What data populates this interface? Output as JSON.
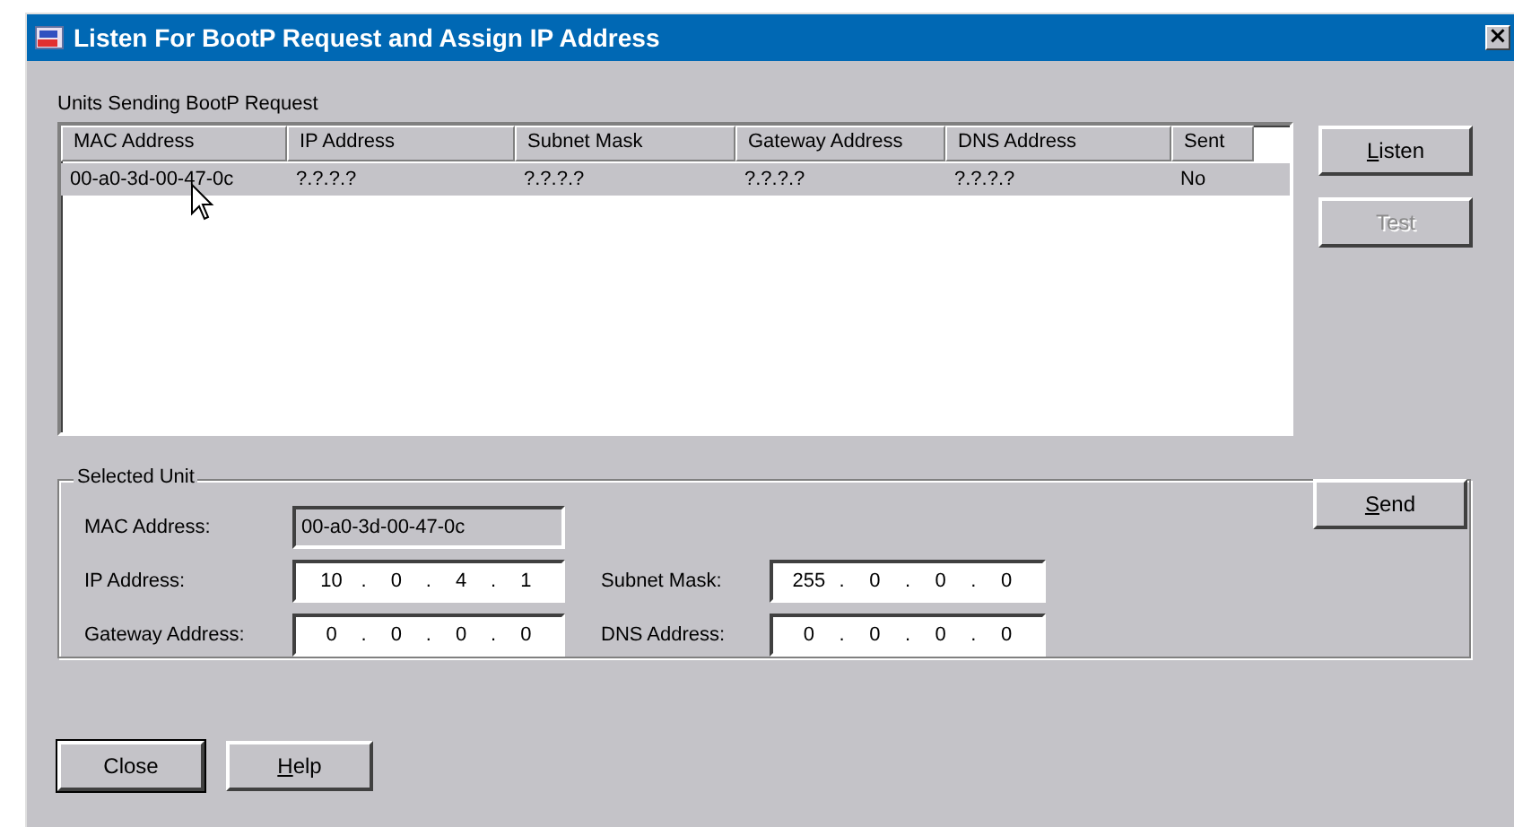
{
  "window": {
    "title": "Listen For BootP Request and Assign IP Address",
    "close_glyph": "×"
  },
  "units": {
    "label": "Units Sending BootP Request",
    "columns": [
      "MAC Address",
      "IP Address",
      "Subnet Mask",
      "Gateway Address",
      "DNS Address",
      "Sent"
    ],
    "rows": [
      {
        "selected": true,
        "cells": [
          "00-a0-3d-00-47-0c",
          "?.?.?.?",
          "?.?.?.?",
          "?.?.?.?",
          "?.?.?.?",
          "No"
        ]
      }
    ]
  },
  "side_buttons": [
    {
      "label": "Listen",
      "disabled": false,
      "underline_first": true
    },
    {
      "label": "Test",
      "disabled": true,
      "underline_first": false
    }
  ],
  "selected_unit": {
    "label": "Selected Unit",
    "separator": ".",
    "mac": {
      "label": "MAC Address:",
      "value": "00-a0-3d-00-47-0c"
    },
    "fields": [
      {
        "label": "IP Address:",
        "octets": [
          "10",
          "0",
          "4",
          "1"
        ]
      },
      {
        "label": "Subnet Mask:",
        "octets": [
          "255",
          "0",
          "0",
          "0"
        ]
      },
      {
        "label": "Gateway Address:",
        "octets": [
          "0",
          "0",
          "0",
          "0"
        ]
      },
      {
        "label": "DNS Address:",
        "octets": [
          "0",
          "0",
          "0",
          "0"
        ]
      }
    ],
    "send": {
      "label": "Send",
      "disabled": false,
      "underline_first": true
    }
  },
  "bottom_buttons": [
    {
      "label": "Close",
      "underline_first": false,
      "default": true
    },
    {
      "label": "Help",
      "underline_first": true,
      "default": false
    }
  ]
}
